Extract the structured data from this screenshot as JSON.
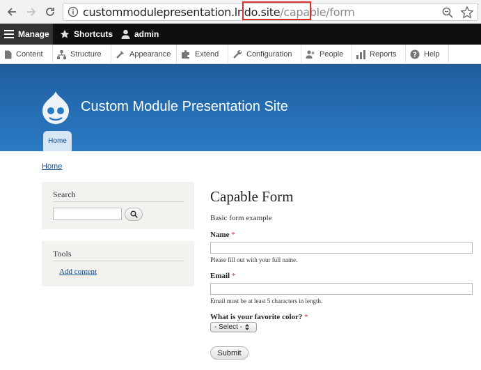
{
  "browser": {
    "url_host": "custommodulepresentation.lndo.site",
    "url_path": "/capable/form"
  },
  "toolbar": {
    "manage_label": "Manage",
    "shortcuts_label": "Shortcuts",
    "user_label": "admin"
  },
  "admin_menu": [
    {
      "label": "Content",
      "icon": "content-icon"
    },
    {
      "label": "Structure",
      "icon": "structure-icon"
    },
    {
      "label": "Appearance",
      "icon": "appearance-icon"
    },
    {
      "label": "Extend",
      "icon": "extend-icon"
    },
    {
      "label": "Configuration",
      "icon": "wrench-icon"
    },
    {
      "label": "People",
      "icon": "people-icon"
    },
    {
      "label": "Reports",
      "icon": "reports-icon"
    },
    {
      "label": "Help",
      "icon": "help-icon"
    }
  ],
  "header": {
    "site_name": "Custom Module Presentation Site",
    "tab_home": "Home"
  },
  "breadcrumb": "Home",
  "sidebar": {
    "search_title": "Search",
    "search_value": "",
    "tools_title": "Tools",
    "tools_link": "Add content"
  },
  "main": {
    "title": "Capable Form",
    "description": "Basic form example",
    "name_label": "Name",
    "name_value": "",
    "name_help": "Please fill out with your full name.",
    "email_label": "Email",
    "email_value": "",
    "email_help": "Email must be at least 5 characters in length.",
    "color_label": "What is your favorite color?",
    "color_selected": "- Select -",
    "required_marker": "*",
    "submit_label": "Submit"
  },
  "colors": {
    "header_blue": "#2b7bc5",
    "link_blue": "#0b4d90",
    "required_red": "#d0261e",
    "url_highlight_red": "#d9302b"
  }
}
